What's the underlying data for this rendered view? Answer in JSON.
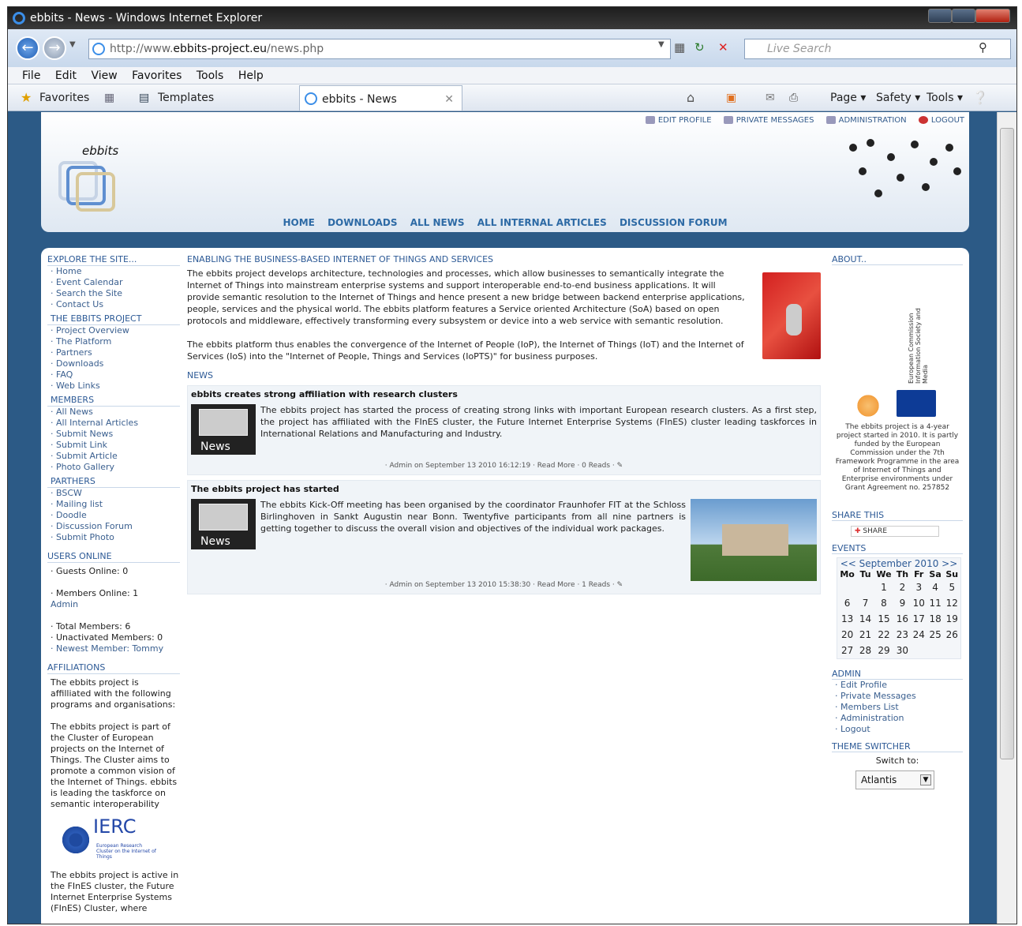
{
  "window": {
    "title": "ebbits - News - Windows Internet Explorer"
  },
  "address": {
    "url_prefix": "http://www.",
    "url_domain": "ebbits-project.eu",
    "url_path": "/news.php",
    "search_placeholder": "Live Search"
  },
  "menu": [
    "File",
    "Edit",
    "View",
    "Favorites",
    "Tools",
    "Help"
  ],
  "favbar": {
    "favorites": "Favorites",
    "templates": "Templates",
    "tab": "ebbits - News",
    "page": "Page ▾",
    "safety": "Safety ▾",
    "tools": "Tools ▾"
  },
  "header": {
    "logo_text": "ebbits",
    "links": [
      "EDIT PROFILE",
      "PRIVATE MESSAGES",
      "ADMINISTRATION",
      "LOGOUT"
    ],
    "nav": [
      "HOME",
      "DOWNLOADS",
      "ALL NEWS",
      "ALL INTERNAL ARTICLES",
      "DISCUSSION FORUM"
    ]
  },
  "left": {
    "explore": "EXPLORE THE SITE...",
    "explore_items": [
      "Home",
      "Event Calendar",
      "Search the Site",
      "Contact Us"
    ],
    "project": "THE EBBITS PROJECT",
    "project_items": [
      "Project Overview",
      "The Platform",
      "Partners",
      "Downloads",
      "FAQ",
      "Web Links"
    ],
    "members": "MEMBERS",
    "members_items": [
      "All News",
      "All Internal Articles",
      "Submit News",
      "Submit Link",
      "Submit Article",
      "Photo Gallery"
    ],
    "partners": "PARTHERS",
    "partners_items": [
      "BSCW",
      "Mailing list",
      "Doodle",
      "Discussion Forum",
      "Submit Photo"
    ],
    "users_online": "USERS ONLINE",
    "guests": "Guests Online: 0",
    "members_online": "Members Online: 1",
    "admin": "Admin",
    "total": "Total Members: 6",
    "unactivated": "Unactivated Members: 0",
    "newest": "Newest Member: Tommy",
    "affiliations": "AFFILIATIONS",
    "aff1": "The ebbits project is affilliated with the following programs and organisations:",
    "aff2": "The ebbits project is part of the Cluster of European projects on the Internet of Things. The Cluster aims to promote a common vision of the Internet of Things. ebbits is leading the taskforce on semantic interoperability",
    "ierc": "IERC",
    "ierc_sub": "European Research Cluster on the Internet of Things",
    "aff3": "The ebbits project is active in the FInES cluster, the Future Internet Enterprise Systems (FInES) Cluster, where"
  },
  "center": {
    "title": "ENABLING THE BUSINESS-BASED INTERNET OF THINGS AND SERVICES",
    "p1": "The ebbits project develops architecture, technologies and processes, which allow businesses to semantically integrate the Internet of Things into mainstream enterprise systems and support interoperable end-to-end business applications. It will provide semantic resolution to the Internet of Things and hence present a new bridge between backend enterprise applications, people, services and the physical world. The ebbits platform features a Service oriented Architecture (SoA) based on open protocols and middleware, effectively transforming every subsystem or device into a web service with semantic resolution.",
    "p2": "The ebbits platform thus enables the convergence of the Internet of People (IoP), the Internet of Things (IoT) and the Internet of Services (IoS) into the \"Internet of People, Things and Services (IoPTS)\" for business purposes.",
    "news_label": "NEWS",
    "news": [
      {
        "title": "ebbits creates strong affiliation with research clusters",
        "img": "News",
        "text": "The ebbits project has started the process of creating strong links with important European research clusters. As a first step, the project has affiliated with the FInES cluster, the Future Internet Enterprise Systems (FInES) cluster leading taskforces in International Relations and Manufacturing and Industry.",
        "meta": "· Admin on September 13 2010 16:12:19 · Read More · 0 Reads · ✎"
      },
      {
        "title": "The ebbits project has started",
        "img": "News",
        "text": "The ebbits Kick-Off meeting has been organised by the coordinator Fraunhofer FIT at the Schloss Birlinghoven in Sankt Augustin near Bonn. Twentyfive participants from all nine partners is getting together to discuss the overall vision and objectives of the individual work packages.",
        "meta": "· Admin on September 13 2010 15:38:30 · Read More · 1 Reads · ✎"
      }
    ]
  },
  "right": {
    "about": "ABOUT..",
    "eu": "European Commission Information Society and Media",
    "about_text": "The ebbits project is a 4-year project started in 2010. It is partly funded by the European Commission under the 7th Framework Programme in the area of Internet of Things and Enterprise environments under Grant Agreement no. 257852",
    "share_title": "SHARE THIS",
    "share": "SHARE",
    "events": "EVENTS",
    "cal_header": "<< September 2010 >>",
    "days": [
      "Mo",
      "Tu",
      "We",
      "Th",
      "Fr",
      "Sa",
      "Su"
    ],
    "weeks": [
      [
        "",
        "",
        "1",
        "2",
        "3",
        "4",
        "5"
      ],
      [
        "6",
        "7",
        "8",
        "9",
        "10",
        "11",
        "12"
      ],
      [
        "13",
        "14",
        "15",
        "16",
        "17",
        "18",
        "19"
      ],
      [
        "20",
        "21",
        "22",
        "23",
        "24",
        "25",
        "26"
      ],
      [
        "27",
        "28",
        "29",
        "30",
        "",
        "",
        ""
      ]
    ],
    "admin": "ADMIN",
    "admin_items": [
      "Edit Profile",
      "Private Messages",
      "Members List",
      "Administration",
      "Logout"
    ],
    "theme": "THEME SWITCHER",
    "switch_to": "Switch to:",
    "theme_value": "Atlantis"
  }
}
